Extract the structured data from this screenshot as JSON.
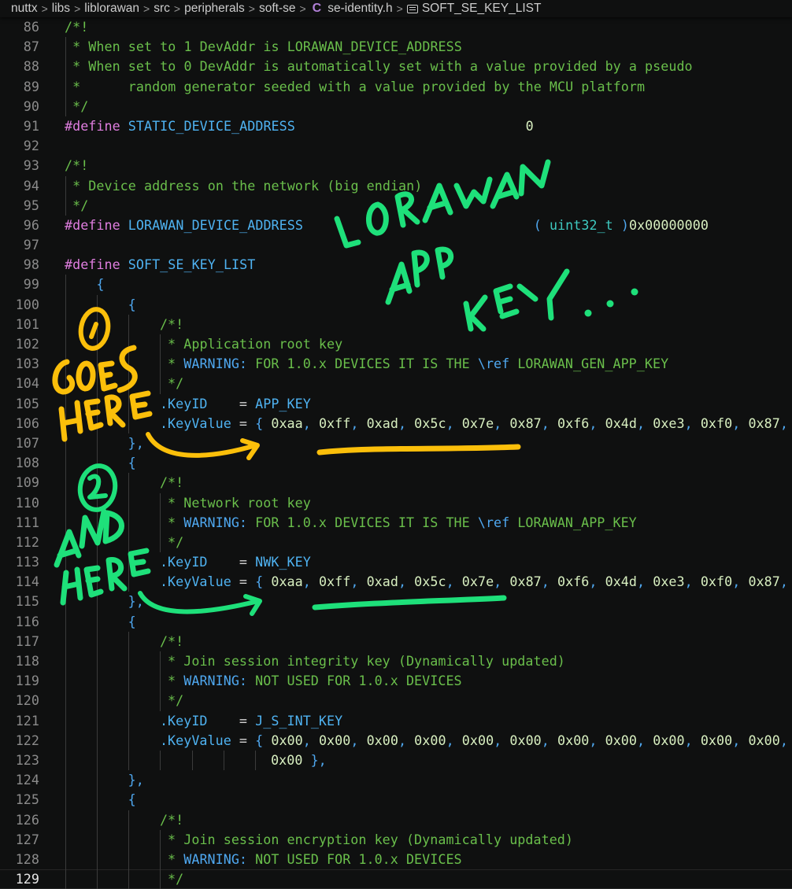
{
  "breadcrumb": {
    "items": [
      "nuttx",
      "libs",
      "liblorawan",
      "src",
      "peripherals",
      "soft-se"
    ],
    "file": "se-identity.h",
    "file_icon": "c-language-icon",
    "symbol": "SOFT_SE_KEY_LIST",
    "symbol_icon": "symbol-constant-icon",
    "separator": ">"
  },
  "editor": {
    "current_line": 129,
    "lines": [
      {
        "n": "86"
      },
      {
        "n": "87"
      },
      {
        "n": "88"
      },
      {
        "n": "89"
      },
      {
        "n": "90"
      },
      {
        "n": "91"
      },
      {
        "n": "92"
      },
      {
        "n": "93"
      },
      {
        "n": "94"
      },
      {
        "n": "95"
      },
      {
        "n": "96"
      },
      {
        "n": "97"
      },
      {
        "n": "98"
      },
      {
        "n": "99"
      },
      {
        "n": "100"
      },
      {
        "n": "101"
      },
      {
        "n": "102"
      },
      {
        "n": "103"
      },
      {
        "n": "104"
      },
      {
        "n": "105"
      },
      {
        "n": "106"
      },
      {
        "n": "107"
      },
      {
        "n": "108"
      },
      {
        "n": "109"
      },
      {
        "n": "110"
      },
      {
        "n": "111"
      },
      {
        "n": "112"
      },
      {
        "n": "113"
      },
      {
        "n": "114"
      },
      {
        "n": "115"
      },
      {
        "n": "116"
      },
      {
        "n": "117"
      },
      {
        "n": "118"
      },
      {
        "n": "119"
      },
      {
        "n": "120"
      },
      {
        "n": "121"
      },
      {
        "n": "122"
      },
      {
        "n": "123"
      },
      {
        "n": "124"
      },
      {
        "n": "125"
      },
      {
        "n": "126"
      },
      {
        "n": "127"
      },
      {
        "n": "128"
      },
      {
        "n": "129"
      }
    ],
    "tokens": {
      "l86": "/*!",
      "l87": " * When set to 1 DevAddr is LORAWAN_DEVICE_ADDRESS",
      "l88": " * When set to 0 DevAddr is automatically set with a value provided by a pseudo",
      "l89": " *      random generator seeded with a value provided by the MCU platform",
      "l90": " */",
      "l91_kw": "#define",
      "l91_name": "STATIC_DEVICE_ADDRESS",
      "l91_val": "0",
      "l93": "/*!",
      "l94": " * Device address on the network (big endian)",
      "l95": " */",
      "l96_kw": "#define",
      "l96_name": "LORAWAN_DEVICE_ADDRESS",
      "l96_open": "(",
      "l96_type": "uint32_t",
      "l96_close": ")",
      "l96_val": "0x00000000",
      "l98_kw": "#define",
      "l98_name": "SOFT_SE_KEY_LIST",
      "open_brace": "{",
      "close_brace_comma": "},",
      "comment_open": "/*!",
      "comment_close": " */",
      "star": " * ",
      "warning_label": "WARNING:",
      "keyid_prop": ".KeyID",
      "keyid_eq": "    = ",
      "keyvalue_prop": ".KeyValue",
      "keyvalue_eq": " = ",
      "l102": "Application root key",
      "l103_a": " FOR 1.0.x DEVICES IT IS THE ",
      "l103_ref": "\\ref",
      "l103_b": " LORAWAN_GEN_APP_KEY",
      "l105_id": "APP_KEY",
      "l110": "Network root key",
      "l111_a": " FOR 1.0.x DEVICES IT IS THE ",
      "l111_ref": "\\ref",
      "l111_b": " LORAWAN_APP_KEY",
      "l113_id": "NWK_KEY",
      "l118": "Join session integrity key (Dynamically updated)",
      "l119_a": " NOT USED FOR 1.0.x DEVICES",
      "l121_id": "J_S_INT_KEY",
      "l123_val": "0x00",
      "l123_end": " },",
      "l127": "Join session encryption key (Dynamically updated)",
      "l128_a": " NOT USED FOR 1.0.x DEVICES",
      "l129": " */",
      "comma": ","
    },
    "app_key_bytes": [
      "0xaa",
      "0xff",
      "0xad",
      "0x5c",
      "0x7e",
      "0x87",
      "0xf6",
      "0x4d",
      "0xe3",
      "0xf0",
      "0x87"
    ],
    "nwk_key_bytes": [
      "0xaa",
      "0xff",
      "0xad",
      "0x5c",
      "0x7e",
      "0x87",
      "0xf6",
      "0x4d",
      "0xe3",
      "0xf0",
      "0x87"
    ],
    "j_s_int_key_bytes": [
      "0x00",
      "0x00",
      "0x00",
      "0x00",
      "0x00",
      "0x00",
      "0x00",
      "0x00",
      "0x00",
      "0x00",
      "0x00"
    ]
  },
  "annotations": {
    "headline": [
      "LORAWAN",
      "APP",
      "KEY..."
    ],
    "marker_1": "1",
    "marker_1_text": [
      "GOES",
      "HERE"
    ],
    "marker_2": "2",
    "marker_2_text": [
      "AND",
      "HERE"
    ],
    "colors": {
      "yellow": "#fbbf0a",
      "green": "#1ee07a"
    }
  },
  "colors": {
    "background": "#0f1010",
    "comment": "#6abf4b",
    "keyword": "#e07ee0",
    "macro": "#4fb3f2",
    "type": "#3ec9c0",
    "number": "#d8efc0",
    "punctuation": "#4fa8f0",
    "line_number": "#8b8b8b"
  }
}
